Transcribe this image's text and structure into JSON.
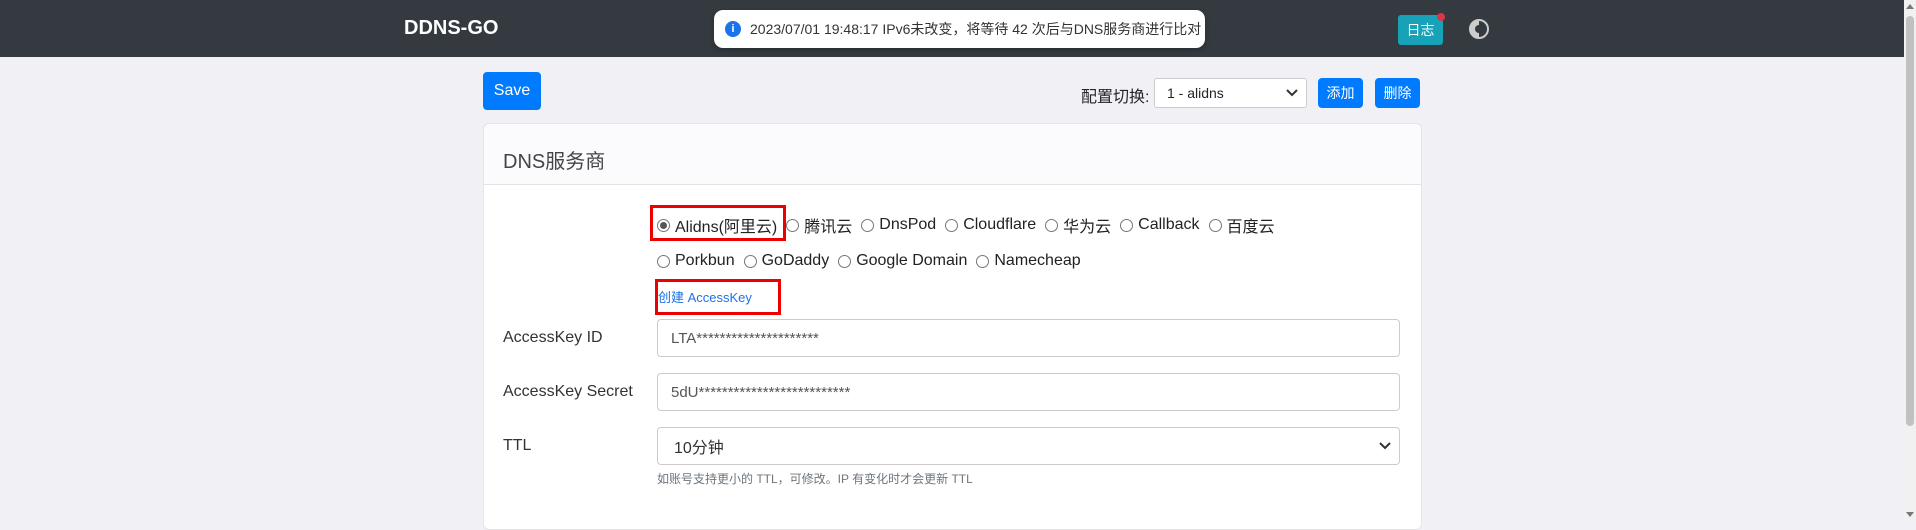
{
  "navbar": {
    "brand": "DDNS-GO",
    "log_label": "日志"
  },
  "toast": {
    "message": "2023/07/01 19:48:17 IPv6未改变，将等待 42 次后与DNS服务商进行比对"
  },
  "toolbar": {
    "save_label": "Save",
    "config_label": "配置切换:",
    "config_selected": "1 - alidns",
    "add_label": "添加",
    "delete_label": "删除"
  },
  "dns_card": {
    "title": "DNS服务商",
    "providers_row1": [
      "Alidns(阿里云)",
      "腾讯云",
      "DnsPod",
      "Cloudflare",
      "华为云",
      "Callback",
      "百度云"
    ],
    "providers_row2": [
      "Porkbun",
      "GoDaddy",
      "Google Domain",
      "Namecheap"
    ],
    "selected_provider": "Alidns(阿里云)",
    "create_key_link": "创建 AccessKey",
    "access_key_id_label": "AccessKey ID",
    "access_key_id_value": "LTA*********************",
    "access_key_secret_label": "AccessKey Secret",
    "access_key_secret_value": "5dU**************************",
    "ttl_label": "TTL",
    "ttl_value": "10分钟",
    "ttl_help": "如账号支持更小的 TTL，可修改。IP 有变化时才会更新 TTL"
  },
  "colors": {
    "navbar_bg": "#343a40",
    "primary": "#007bff",
    "info": "#17a2b8",
    "highlight": "#ee0000"
  },
  "icons": [
    "info-icon",
    "theme-toggle-icon",
    "chevron-down-icon"
  ]
}
